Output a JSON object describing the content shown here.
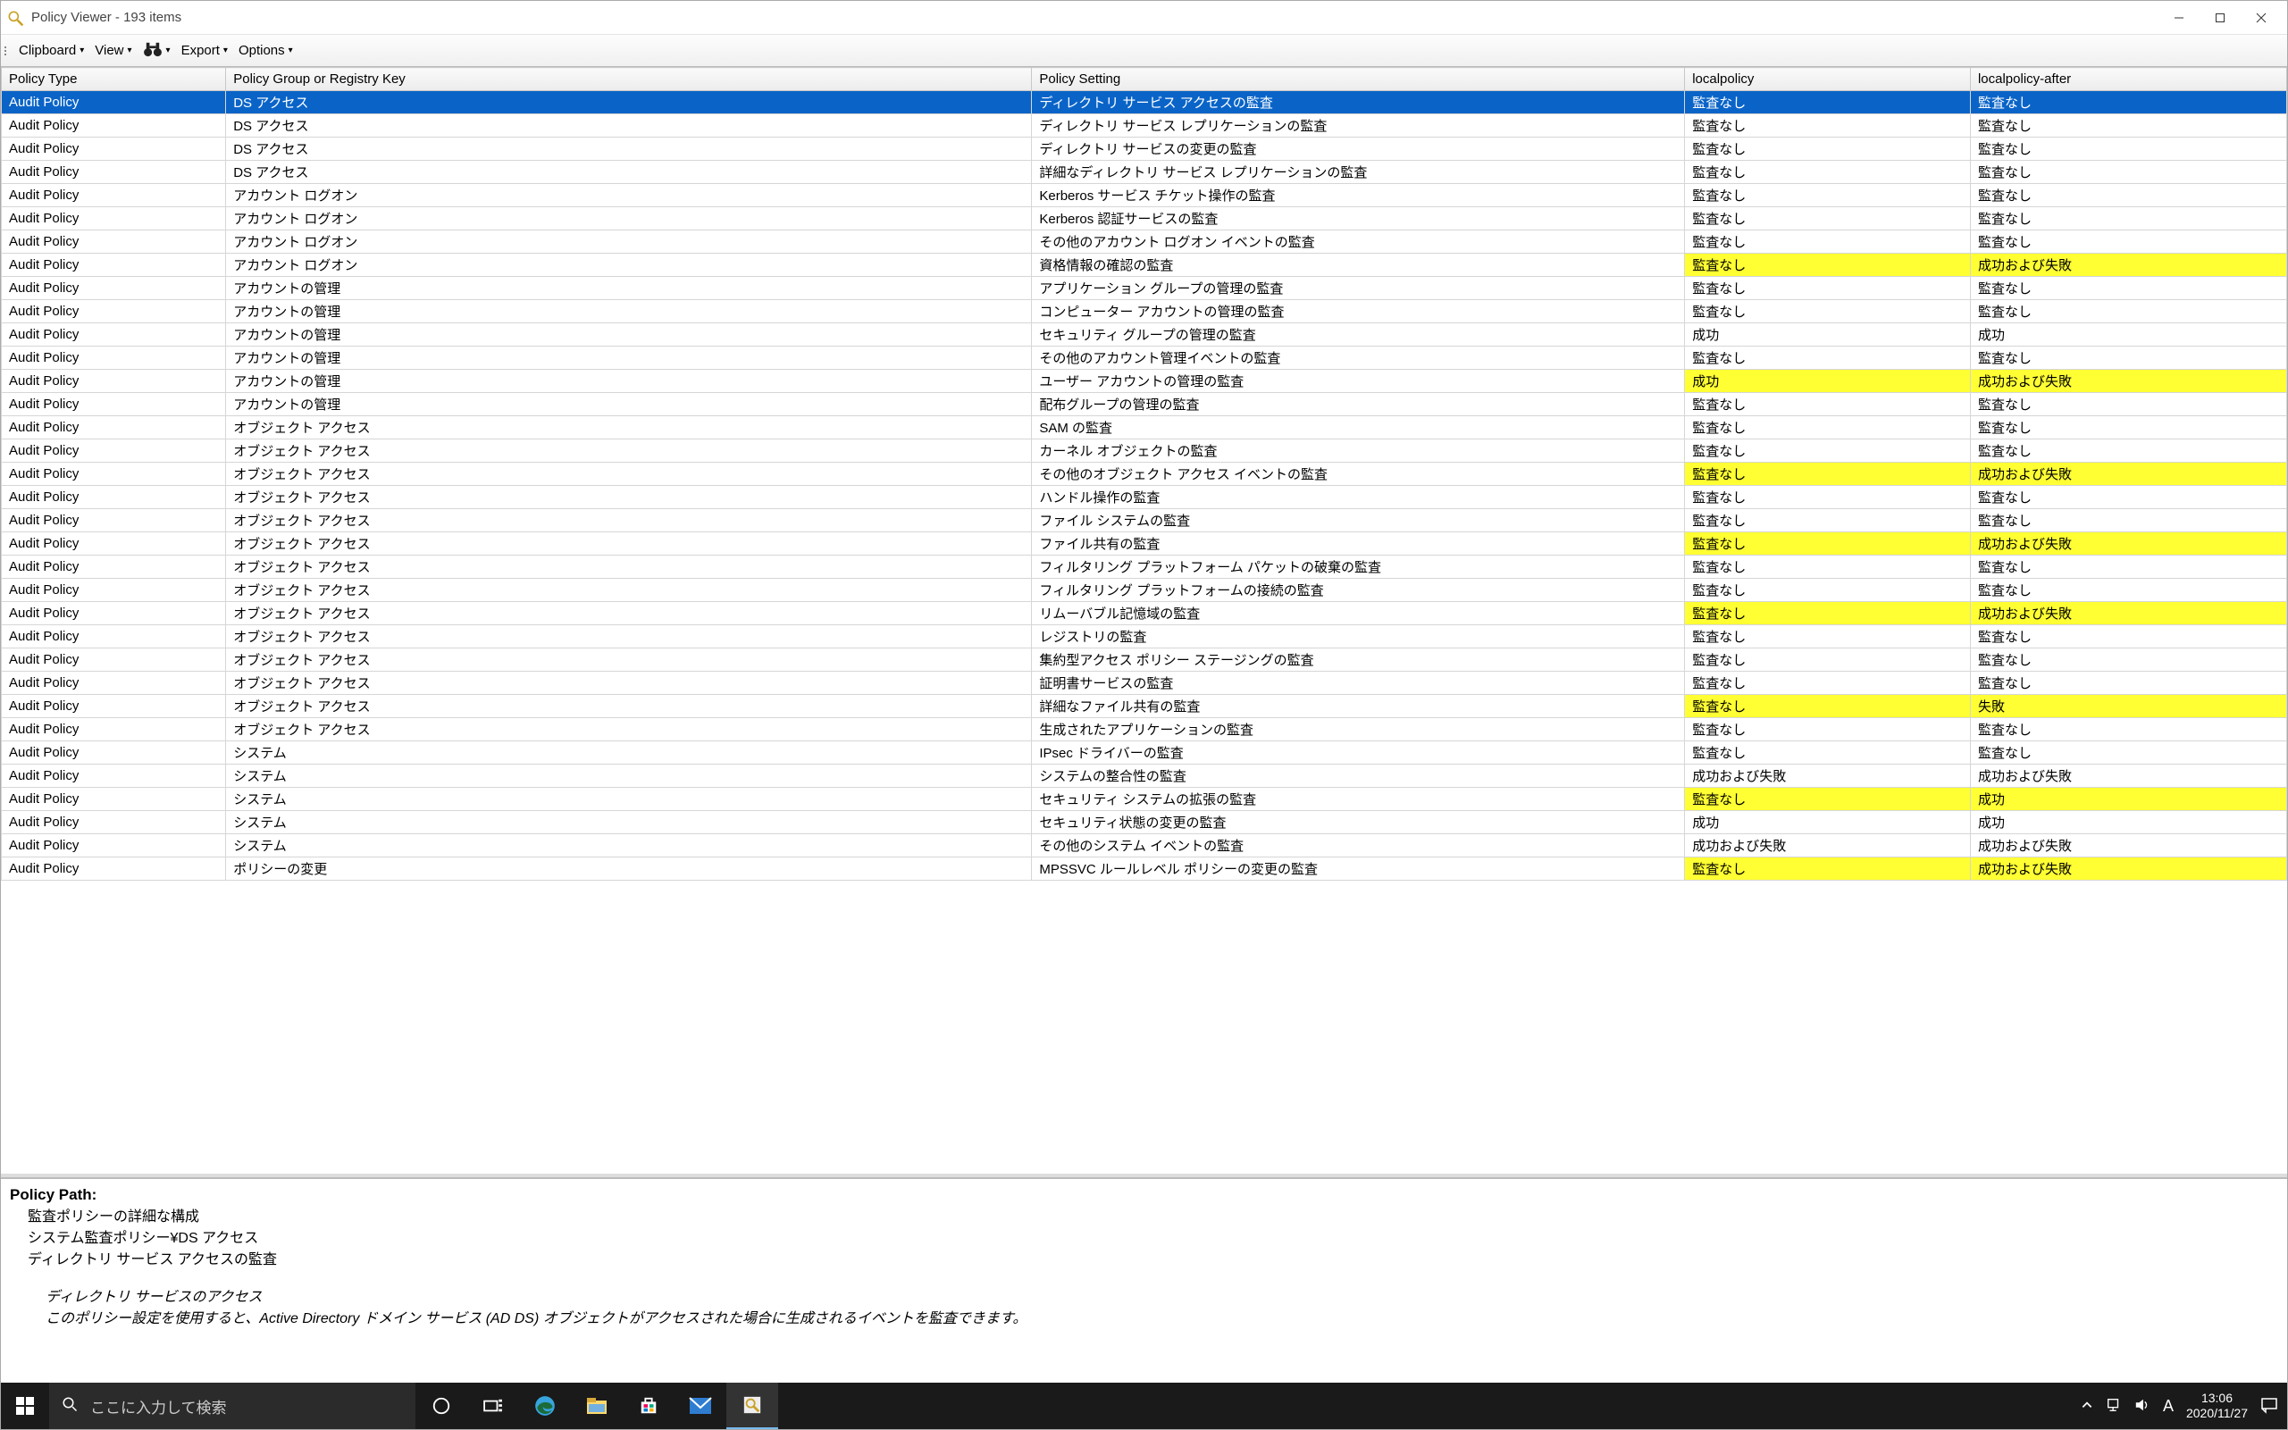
{
  "window": {
    "title": "Policy Viewer - 193 items"
  },
  "toolbar": {
    "clipboard": "Clipboard",
    "view": "View",
    "export": "Export",
    "options": "Options"
  },
  "columns": [
    "Policy Type",
    "Policy Group or Registry Key",
    "Policy Setting",
    "localpolicy",
    "localpolicy-after"
  ],
  "rows": [
    {
      "t": "Audit Policy",
      "g": "DS アクセス",
      "s": "ディレクトリ サービス アクセスの監査",
      "l": "監査なし",
      "a": "監査なし",
      "sel": true
    },
    {
      "t": "Audit Policy",
      "g": "DS アクセス",
      "s": "ディレクトリ サービス レプリケーションの監査",
      "l": "監査なし",
      "a": "監査なし"
    },
    {
      "t": "Audit Policy",
      "g": "DS アクセス",
      "s": "ディレクトリ サービスの変更の監査",
      "l": "監査なし",
      "a": "監査なし"
    },
    {
      "t": "Audit Policy",
      "g": "DS アクセス",
      "s": "詳細なディレクトリ サービス レプリケーションの監査",
      "l": "監査なし",
      "a": "監査なし"
    },
    {
      "t": "Audit Policy",
      "g": "アカウント ログオン",
      "s": "Kerberos サービス チケット操作の監査",
      "l": "監査なし",
      "a": "監査なし"
    },
    {
      "t": "Audit Policy",
      "g": "アカウント ログオン",
      "s": "Kerberos 認証サービスの監査",
      "l": "監査なし",
      "a": "監査なし"
    },
    {
      "t": "Audit Policy",
      "g": "アカウント ログオン",
      "s": "その他のアカウント ログオン イベントの監査",
      "l": "監査なし",
      "a": "監査なし"
    },
    {
      "t": "Audit Policy",
      "g": "アカウント ログオン",
      "s": "資格情報の確認の監査",
      "l": "監査なし",
      "a": "成功および失敗",
      "hl": true
    },
    {
      "t": "Audit Policy",
      "g": "アカウントの管理",
      "s": "アプリケーション グループの管理の監査",
      "l": "監査なし",
      "a": "監査なし"
    },
    {
      "t": "Audit Policy",
      "g": "アカウントの管理",
      "s": "コンピューター アカウントの管理の監査",
      "l": "監査なし",
      "a": "監査なし"
    },
    {
      "t": "Audit Policy",
      "g": "アカウントの管理",
      "s": "セキュリティ グループの管理の監査",
      "l": "成功",
      "a": "成功"
    },
    {
      "t": "Audit Policy",
      "g": "アカウントの管理",
      "s": "その他のアカウント管理イベントの監査",
      "l": "監査なし",
      "a": "監査なし"
    },
    {
      "t": "Audit Policy",
      "g": "アカウントの管理",
      "s": "ユーザー アカウントの管理の監査",
      "l": "成功",
      "a": "成功および失敗",
      "hl": true
    },
    {
      "t": "Audit Policy",
      "g": "アカウントの管理",
      "s": "配布グループの管理の監査",
      "l": "監査なし",
      "a": "監査なし"
    },
    {
      "t": "Audit Policy",
      "g": "オブジェクト アクセス",
      "s": "SAM の監査",
      "l": "監査なし",
      "a": "監査なし"
    },
    {
      "t": "Audit Policy",
      "g": "オブジェクト アクセス",
      "s": "カーネル オブジェクトの監査",
      "l": "監査なし",
      "a": "監査なし"
    },
    {
      "t": "Audit Policy",
      "g": "オブジェクト アクセス",
      "s": "その他のオブジェクト アクセス イベントの監査",
      "l": "監査なし",
      "a": "成功および失敗",
      "hl": true
    },
    {
      "t": "Audit Policy",
      "g": "オブジェクト アクセス",
      "s": "ハンドル操作の監査",
      "l": "監査なし",
      "a": "監査なし"
    },
    {
      "t": "Audit Policy",
      "g": "オブジェクト アクセス",
      "s": "ファイル システムの監査",
      "l": "監査なし",
      "a": "監査なし"
    },
    {
      "t": "Audit Policy",
      "g": "オブジェクト アクセス",
      "s": "ファイル共有の監査",
      "l": "監査なし",
      "a": "成功および失敗",
      "hl": true
    },
    {
      "t": "Audit Policy",
      "g": "オブジェクト アクセス",
      "s": "フィルタリング プラットフォーム パケットの破棄の監査",
      "l": "監査なし",
      "a": "監査なし"
    },
    {
      "t": "Audit Policy",
      "g": "オブジェクト アクセス",
      "s": "フィルタリング プラットフォームの接続の監査",
      "l": "監査なし",
      "a": "監査なし"
    },
    {
      "t": "Audit Policy",
      "g": "オブジェクト アクセス",
      "s": "リムーバブル記憶域の監査",
      "l": "監査なし",
      "a": "成功および失敗",
      "hl": true
    },
    {
      "t": "Audit Policy",
      "g": "オブジェクト アクセス",
      "s": "レジストリの監査",
      "l": "監査なし",
      "a": "監査なし"
    },
    {
      "t": "Audit Policy",
      "g": "オブジェクト アクセス",
      "s": "集約型アクセス ポリシー ステージングの監査",
      "l": "監査なし",
      "a": "監査なし"
    },
    {
      "t": "Audit Policy",
      "g": "オブジェクト アクセス",
      "s": "証明書サービスの監査",
      "l": "監査なし",
      "a": "監査なし"
    },
    {
      "t": "Audit Policy",
      "g": "オブジェクト アクセス",
      "s": "詳細なファイル共有の監査",
      "l": "監査なし",
      "a": "失敗",
      "hl": true
    },
    {
      "t": "Audit Policy",
      "g": "オブジェクト アクセス",
      "s": "生成されたアプリケーションの監査",
      "l": "監査なし",
      "a": "監査なし"
    },
    {
      "t": "Audit Policy",
      "g": "システム",
      "s": "IPsec ドライバーの監査",
      "l": "監査なし",
      "a": "監査なし"
    },
    {
      "t": "Audit Policy",
      "g": "システム",
      "s": "システムの整合性の監査",
      "l": "成功および失敗",
      "a": "成功および失敗"
    },
    {
      "t": "Audit Policy",
      "g": "システム",
      "s": "セキュリティ システムの拡張の監査",
      "l": "監査なし",
      "a": "成功",
      "hl": true
    },
    {
      "t": "Audit Policy",
      "g": "システム",
      "s": "セキュリティ状態の変更の監査",
      "l": "成功",
      "a": "成功"
    },
    {
      "t": "Audit Policy",
      "g": "システム",
      "s": "その他のシステム イベントの監査",
      "l": "成功および失敗",
      "a": "成功および失敗"
    },
    {
      "t": "Audit Policy",
      "g": "ポリシーの変更",
      "s": "MPSSVC ルールレベル ポリシーの変更の監査",
      "l": "監査なし",
      "a": "成功および失敗",
      "hl": true
    }
  ],
  "details": {
    "heading": "Policy Path:",
    "lines": [
      "監査ポリシーの詳細な構成",
      "システム監査ポリシー¥DS アクセス",
      "ディレクトリ サービス アクセスの監査"
    ],
    "body_lines": [
      "ディレクトリ サービスのアクセス",
      "",
      "このポリシー設定を使用すると、Active Directory ドメイン サービス (AD DS) オブジェクトがアクセスされた場合に生成されるイベントを監査できます。"
    ]
  },
  "taskbar": {
    "search_placeholder": "ここに入力して検索",
    "ime": "A",
    "time": "13:06",
    "date": "2020/11/27"
  }
}
